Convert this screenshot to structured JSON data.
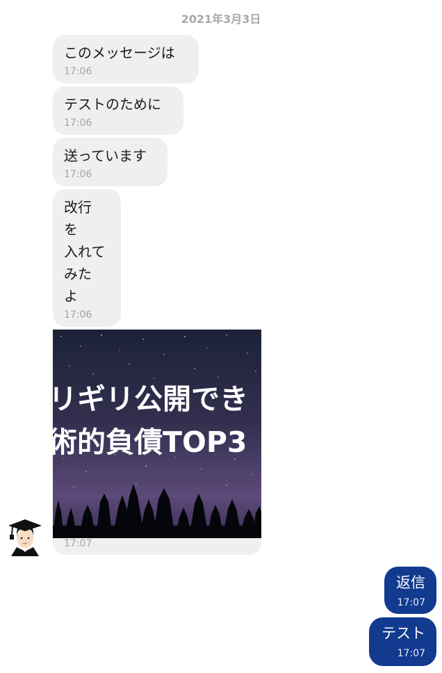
{
  "date": "2021年3月3日",
  "incoming": [
    {
      "text": "このメッセージは",
      "time": "17:06"
    },
    {
      "text": "テストのために",
      "time": "17:06"
    },
    {
      "text": "送っています",
      "time": "17:06"
    },
    {
      "text": "改行\nを\n入れて\nみた\nよ",
      "time": "17:06"
    }
  ],
  "image_message": {
    "line1": "リギリ公開でき",
    "line2": "術的負債TOP3",
    "time": "17:07"
  },
  "outgoing": [
    {
      "text": "返信",
      "time": "17:07"
    },
    {
      "text": "テスト",
      "time": "17:07"
    }
  ],
  "colors": {
    "incoming_bubble": "#efefef",
    "outgoing_bubble": "#123a8f",
    "timestamp": "#a3a3a3"
  }
}
